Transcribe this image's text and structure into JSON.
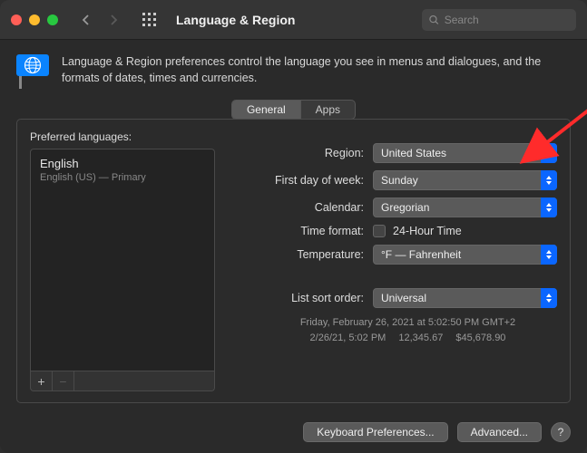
{
  "header": {
    "title": "Language & Region",
    "search_placeholder": "Search"
  },
  "intro": {
    "text": "Language & Region preferences control the language you see in menus and dialogues, and the formats of dates, times and currencies."
  },
  "tabs": {
    "general": "General",
    "apps": "Apps"
  },
  "left": {
    "label": "Preferred languages:",
    "language_name": "English",
    "language_sub": "English (US) — Primary"
  },
  "form": {
    "region_label": "Region:",
    "region_value": "United States",
    "first_day_label": "First day of week:",
    "first_day_value": "Sunday",
    "calendar_label": "Calendar:",
    "calendar_value": "Gregorian",
    "time_format_label": "Time format:",
    "time_format_option": "24-Hour Time",
    "temperature_label": "Temperature:",
    "temperature_value": "°F — Fahrenheit",
    "list_sort_label": "List sort order:",
    "list_sort_value": "Universal"
  },
  "info": {
    "line1": "Friday, February 26, 2021 at 5:02:50 PM GMT+2",
    "line2": "2/26/21, 5:02 PM  12,345.67  $45,678.90"
  },
  "footer": {
    "keyboard": "Keyboard Preferences...",
    "advanced": "Advanced...",
    "help": "?"
  }
}
